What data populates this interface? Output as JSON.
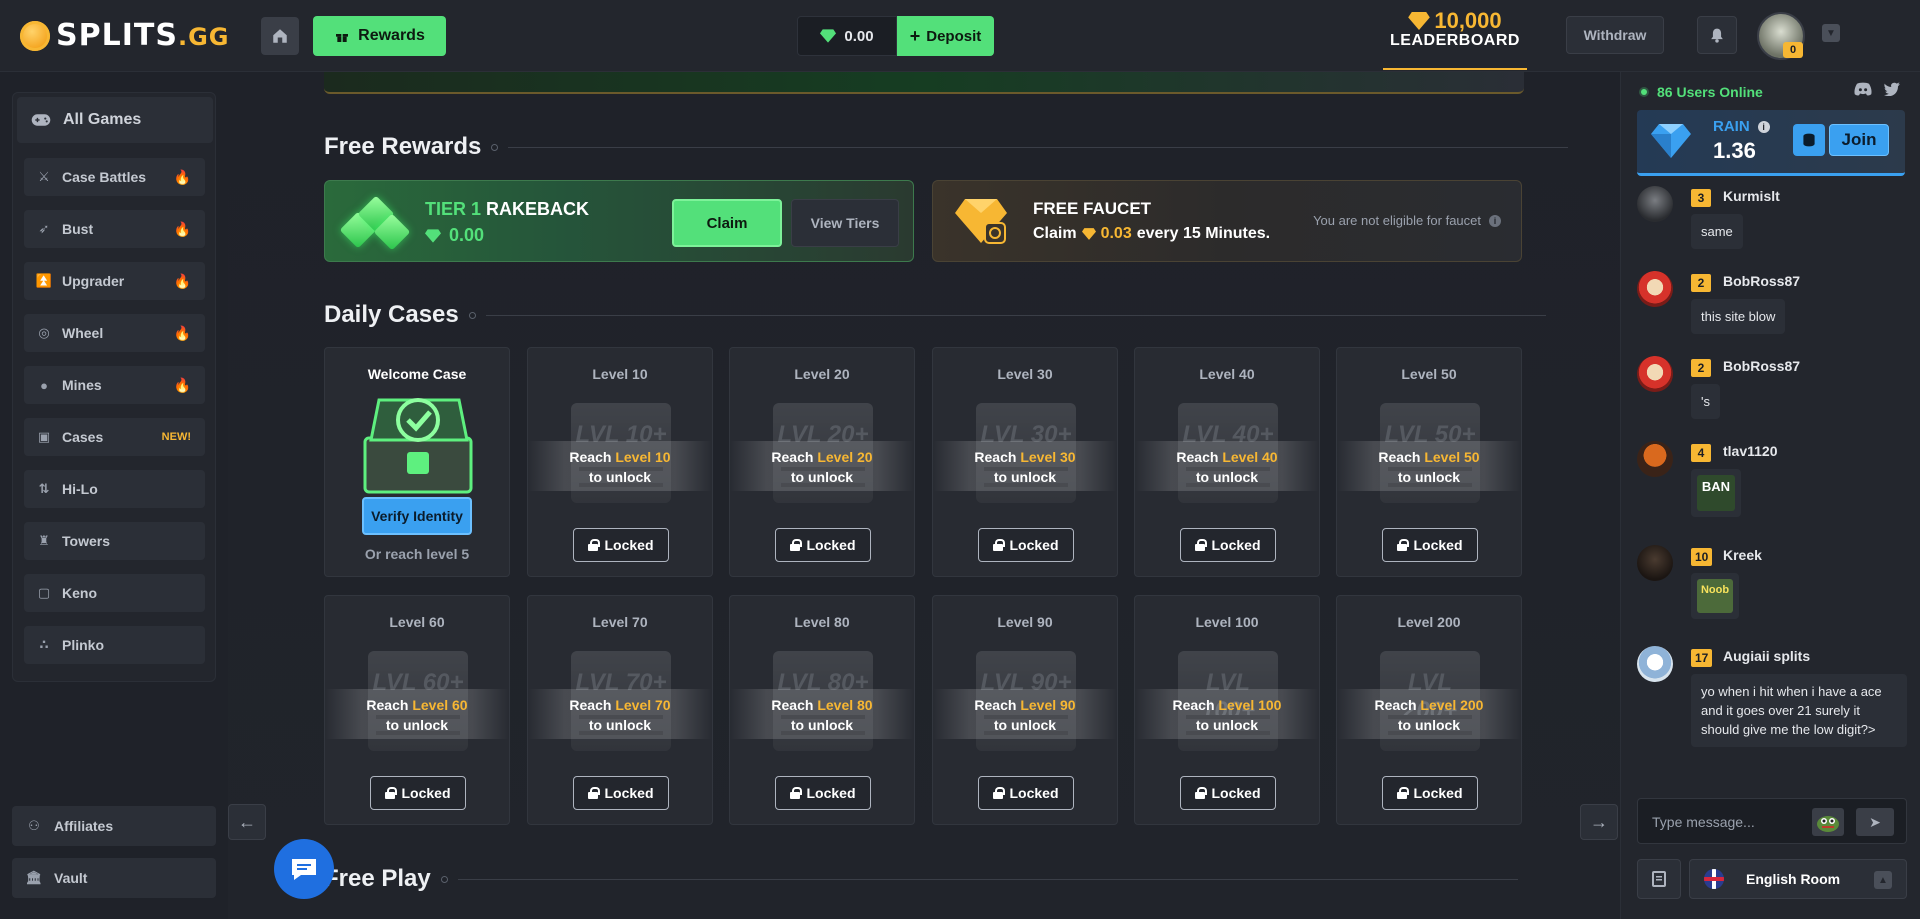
{
  "header": {
    "logo_text": "SPLITS",
    "logo_tld": ".GG",
    "rewards_label": "Rewards",
    "balance": "0.00",
    "deposit_label": "Deposit",
    "leaderboard_amount": "10,000",
    "leaderboard_label": "LEADERBOARD",
    "withdraw_label": "Withdraw",
    "user_level": "0"
  },
  "sidebar": {
    "all_games_label": "All Games",
    "items": [
      {
        "label": "Case Battles",
        "icon": "swords-icon",
        "badge": "fire"
      },
      {
        "label": "Bust",
        "icon": "rocket-icon",
        "badge": "fire"
      },
      {
        "label": "Upgrader",
        "icon": "upgrade-icon",
        "badge": "fire"
      },
      {
        "label": "Wheel",
        "icon": "wheel-icon",
        "badge": "fire"
      },
      {
        "label": "Mines",
        "icon": "mine-icon",
        "badge": "fire"
      },
      {
        "label": "Cases",
        "icon": "case-icon",
        "badge": "NEW!"
      },
      {
        "label": "Hi-Lo",
        "icon": "hilo-icon",
        "badge": ""
      },
      {
        "label": "Towers",
        "icon": "tower-icon",
        "badge": ""
      },
      {
        "label": "Keno",
        "icon": "keno-icon",
        "badge": ""
      },
      {
        "label": "Plinko",
        "icon": "plinko-icon",
        "badge": ""
      }
    ],
    "bottom_links": [
      {
        "label": "Affiliates",
        "icon": "affiliates-icon"
      },
      {
        "label": "Vault",
        "icon": "vault-icon"
      }
    ]
  },
  "free_rewards": {
    "title": "Free Rewards",
    "rakeback": {
      "tier_prefix": "TIER 1",
      "tier_suffix": "RAKEBACK",
      "value": "0.00",
      "claim_label": "Claim",
      "view_tiers_label": "View Tiers"
    },
    "faucet": {
      "title": "FREE FAUCET",
      "claim_prefix": "Claim",
      "amount": "0.03",
      "claim_suffix": "every 15 Minutes.",
      "note": "You are not eligible for faucet"
    }
  },
  "daily_cases": {
    "title": "Daily Cases",
    "welcome": {
      "title": "Welcome Case",
      "verify_label": "Verify Identity",
      "note": "Or reach level 5"
    },
    "reach_prefix": "Reach",
    "to_unlock": "to unlock",
    "locked_label": "Locked",
    "cases": [
      {
        "title": "Level 10",
        "level": "Level 10",
        "crate": "LVL 10+"
      },
      {
        "title": "Level 20",
        "level": "Level 20",
        "crate": "LVL 20+"
      },
      {
        "title": "Level 30",
        "level": "Level 30",
        "crate": "LVL 30+"
      },
      {
        "title": "Level 40",
        "level": "Level 40",
        "crate": "LVL 40+"
      },
      {
        "title": "Level 50",
        "level": "Level 50",
        "crate": "LVL 50+"
      },
      {
        "title": "Level 60",
        "level": "Level 60",
        "crate": "LVL 60+"
      },
      {
        "title": "Level 70",
        "level": "Level 70",
        "crate": "LVL 70+"
      },
      {
        "title": "Level 80",
        "level": "Level 80",
        "crate": "LVL 80+"
      },
      {
        "title": "Level 90",
        "level": "Level 90",
        "crate": "LVL 90+"
      },
      {
        "title": "Level 100",
        "level": "Level 100",
        "crate": "LVL 100+"
      },
      {
        "title": "Level 200",
        "level": "Level 200",
        "crate": "LVL 200+"
      }
    ]
  },
  "free_play": {
    "title": "Free Play"
  },
  "chat": {
    "online_text": "86 Users Online",
    "rain_label": "RAIN",
    "rain_value": "1.36",
    "join_label": "Join",
    "messages": [
      {
        "level": "3",
        "name": "Kurmislt",
        "text": "same"
      },
      {
        "level": "2",
        "name": "BobRoss87",
        "text": "this site blow"
      },
      {
        "level": "2",
        "name": "BobRoss87",
        "text": "'s"
      },
      {
        "level": "4",
        "name": "tlav1120",
        "emote": "BAN"
      },
      {
        "level": "10",
        "name": "Kreek",
        "emote": "Noob"
      },
      {
        "level": "17",
        "name": "Augiaii splits",
        "text": "yo when i hit when i have a ace and it goes over 21 surely it should give me the low digit?>"
      }
    ],
    "input_placeholder": "Type message...",
    "room_label": "English Room"
  },
  "colors": {
    "accent_green": "#53e07a",
    "gold": "#f7b733",
    "blue": "#3aa0f0",
    "background": "#1f2229"
  }
}
